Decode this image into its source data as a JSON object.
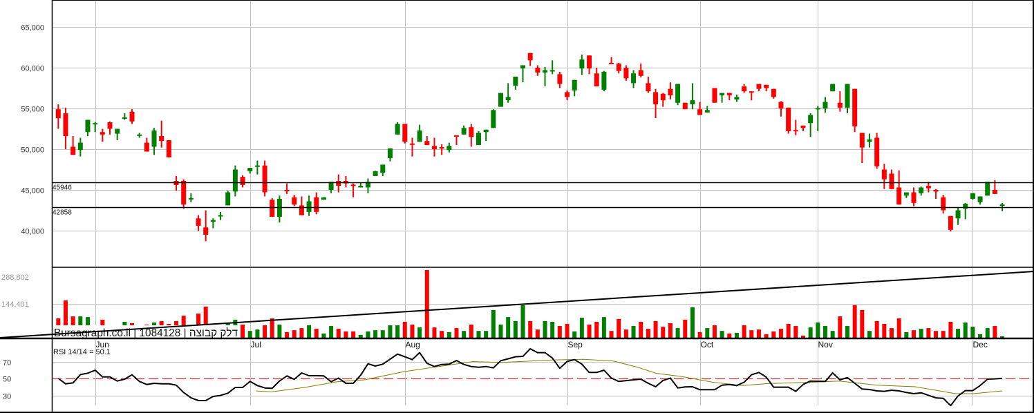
{
  "chart_data": {
    "type": "candlestick",
    "title": "",
    "watermark": "Bursagraph.co.il | 1084128 | דלק קבוצה",
    "colors": {
      "up": "#008000",
      "down": "#ff0000",
      "grid": "#c0c0c0",
      "rsi": "#000000",
      "rsi_ma": "#808000",
      "rsi_mid": "#ff0000"
    },
    "months": [
      {
        "label": "Jun",
        "index": 5
      },
      {
        "label": "Jul",
        "index": 26
      },
      {
        "label": "Aug",
        "index": 47
      },
      {
        "label": "Sep",
        "index": 69
      },
      {
        "label": "Oct",
        "index": 87
      },
      {
        "label": "Nov",
        "index": 103
      },
      {
        "label": "Dec",
        "index": 124
      }
    ],
    "price_axis": {
      "ylim": [
        35590,
        68300
      ],
      "ticks": [
        65000,
        60000,
        55000,
        50000,
        45000,
        40000
      ],
      "labels": [
        "65,000",
        "60,000",
        "55,000",
        "50,000",
        "45,000",
        "40,000"
      ]
    },
    "levels": [
      {
        "value": 45946,
        "label": "45946"
      },
      {
        "value": 42858,
        "label": "42858"
      }
    ],
    "ohlc_fields": [
      "open",
      "high",
      "low",
      "close"
    ],
    "ohlc": [
      [
        54900,
        55500,
        52500,
        53800
      ],
      [
        54400,
        55100,
        50000,
        51600
      ],
      [
        50300,
        51600,
        49300,
        49300
      ],
      [
        49900,
        51400,
        49100,
        50800
      ],
      [
        52100,
        53600,
        51600,
        53600
      ],
      [
        53150,
        53330,
        52100,
        53200
      ],
      [
        52100,
        52500,
        50900,
        51800
      ],
      [
        53300,
        53400,
        51800,
        52500
      ],
      [
        51900,
        52500,
        51100,
        52500
      ],
      [
        53850,
        54400,
        53600,
        53900
      ],
      [
        54600,
        54900,
        53100,
        53400
      ],
      [
        51750,
        52000,
        51400,
        51800
      ],
      [
        50800,
        51400,
        49700,
        49700
      ],
      [
        50300,
        52600,
        49300,
        52300
      ],
      [
        51600,
        53500,
        50200,
        51000
      ],
      [
        51100,
        51100,
        49000,
        49000
      ],
      [
        46100,
        46700,
        44900,
        45600
      ],
      [
        46100,
        46300,
        42700,
        43200
      ],
      [
        43950,
        44600,
        43500,
        44000
      ],
      [
        41500,
        41900,
        40000,
        40600
      ],
      [
        40400,
        42500,
        38700,
        39500
      ],
      [
        41100,
        41500,
        40300,
        41300
      ],
      [
        41850,
        42300,
        41300,
        41900
      ],
      [
        43100,
        44900,
        43100,
        44700
      ],
      [
        44800,
        48000,
        44200,
        47500
      ],
      [
        46600,
        46800,
        45300,
        45600
      ],
      [
        47300,
        47700,
        47000,
        47700
      ],
      [
        47950,
        48600,
        46900,
        48000
      ],
      [
        48000,
        48600,
        44200,
        44700
      ],
      [
        43800,
        44000,
        41700,
        41700
      ],
      [
        41700,
        44300,
        41000,
        43900
      ],
      [
        45000,
        45800,
        44500,
        44900
      ],
      [
        44100,
        44400,
        43000,
        43200
      ],
      [
        43100,
        44200,
        41900,
        41900
      ],
      [
        42300,
        44300,
        41800,
        43600
      ],
      [
        44100,
        44700,
        42000,
        42300
      ],
      [
        43800,
        44100,
        43800,
        44100
      ],
      [
        45000,
        46000,
        44600,
        46000
      ],
      [
        46100,
        46900,
        44700,
        45500
      ],
      [
        46100,
        46700,
        45300,
        45800
      ],
      [
        45650,
        45800,
        44100,
        45600
      ],
      [
        45300,
        45900,
        45300,
        45500
      ],
      [
        45300,
        46400,
        44600,
        46000
      ],
      [
        46700,
        47350,
        46700,
        47300
      ],
      [
        47100,
        48100,
        46700,
        48100
      ],
      [
        48900,
        50100,
        48500,
        50100
      ],
      [
        51800,
        53300,
        51800,
        53100
      ],
      [
        53100,
        53100,
        50700,
        50900
      ],
      [
        50700,
        51400,
        49100,
        50650
      ],
      [
        50900,
        53000,
        50900,
        52300
      ],
      [
        51000,
        51600,
        50500,
        50500
      ],
      [
        50400,
        51400,
        49100,
        50000
      ],
      [
        50250,
        50600,
        49300,
        50225
      ],
      [
        49900,
        50800,
        49600,
        50400
      ],
      [
        51700,
        51700,
        50500,
        51650
      ],
      [
        51800,
        52900,
        51800,
        52600
      ],
      [
        52700,
        53100,
        50300,
        51500
      ],
      [
        50500,
        52200,
        50500,
        52000
      ],
      [
        52100,
        52400,
        51000,
        52400
      ],
      [
        52600,
        54900,
        52600,
        54800
      ],
      [
        55200,
        56900,
        55200,
        56900
      ],
      [
        56000,
        58100,
        55700,
        56400
      ],
      [
        57800,
        58900,
        57300,
        58900
      ],
      [
        59900,
        60300,
        58200,
        60300
      ],
      [
        61800,
        61800,
        60200,
        60900
      ],
      [
        60000,
        60300,
        59000,
        59400
      ],
      [
        59400,
        60100,
        57700,
        59700
      ],
      [
        59650,
        60900,
        59200,
        59700
      ],
      [
        59200,
        59500,
        57500,
        58000
      ],
      [
        57000,
        57200,
        56000,
        56400
      ],
      [
        57200,
        58500,
        56500,
        58500
      ],
      [
        59900,
        61600,
        59100,
        61000
      ],
      [
        61500,
        61500,
        59200,
        59900
      ],
      [
        59300,
        60000,
        57700,
        57700
      ],
      [
        57300,
        59600,
        57100,
        59500
      ],
      [
        60600,
        61300,
        60550,
        60560
      ],
      [
        60500,
        60600,
        59300,
        59600
      ],
      [
        60000,
        60300,
        58400,
        58700
      ],
      [
        58100,
        59700,
        57500,
        59300
      ],
      [
        59700,
        60500,
        58800,
        59000
      ],
      [
        58100,
        58900,
        56900,
        57100
      ],
      [
        57000,
        57400,
        53800,
        55500
      ],
      [
        56800,
        56900,
        55200,
        56000
      ],
      [
        57400,
        58200,
        56100,
        56600
      ],
      [
        55700,
        58000,
        55400,
        58000
      ],
      [
        55700,
        55700,
        54900,
        54900
      ],
      [
        55500,
        58100,
        54900,
        56000
      ],
      [
        54900,
        55800,
        54200,
        54200
      ],
      [
        54500,
        55300,
        54500,
        54800
      ],
      [
        57500,
        57500,
        55700,
        55700
      ],
      [
        56600,
        56900,
        55700,
        56900
      ],
      [
        56900,
        56900,
        56000,
        56600
      ],
      [
        56100,
        56700,
        55800,
        56400
      ],
      [
        57700,
        58000,
        56900,
        57100
      ],
      [
        57100,
        57100,
        56000,
        57050
      ],
      [
        58000,
        58000,
        57100,
        57400
      ],
      [
        57900,
        57900,
        57100,
        57500
      ],
      [
        57400,
        57400,
        56200,
        56400
      ],
      [
        55800,
        55900,
        54000,
        55000
      ],
      [
        55100,
        55100,
        51900,
        52200
      ],
      [
        52350,
        53600,
        51700,
        52300
      ],
      [
        52900,
        52900,
        52200,
        52600
      ],
      [
        53200,
        54400,
        51500,
        54200
      ],
      [
        55000,
        55300,
        52200,
        55050
      ],
      [
        55000,
        56400,
        54500,
        55800
      ],
      [
        57100,
        58000,
        57100,
        58000
      ],
      [
        55700,
        57100,
        54600,
        55100
      ],
      [
        55100,
        58000,
        54400,
        58000
      ],
      [
        57400,
        57400,
        52100,
        52800
      ],
      [
        52000,
        52000,
        48300,
        50200
      ],
      [
        50900,
        51900,
        50200,
        51200
      ],
      [
        51400,
        52000,
        47600,
        47900
      ],
      [
        47500,
        48200,
        45100,
        46300
      ],
      [
        47000,
        47500,
        45100,
        45100
      ],
      [
        45300,
        47400,
        43200,
        43200
      ],
      [
        44300,
        44700,
        44000,
        44700
      ],
      [
        44700,
        45300,
        43000,
        43400
      ],
      [
        44600,
        45400,
        44300,
        45300
      ],
      [
        45500,
        46000,
        44700,
        45200
      ],
      [
        45000,
        45100,
        43900,
        44800
      ],
      [
        44100,
        44400,
        42100,
        42500
      ],
      [
        41800,
        41800,
        39900,
        40100
      ],
      [
        41500,
        42800,
        40700,
        42500
      ],
      [
        42700,
        43400,
        41400,
        43300
      ],
      [
        43900,
        44600,
        43800,
        44600
      ],
      [
        43500,
        44200,
        43200,
        44200
      ],
      [
        44300,
        46000,
        44300,
        46000
      ],
      [
        45000,
        46200,
        44500,
        44500
      ],
      [
        43200,
        43400,
        42400,
        43220
      ]
    ],
    "volume_axis": {
      "ticks": [
        288802,
        144401
      ],
      "labels": [
        "288,802",
        "144,401"
      ]
    },
    "volume": [
      82500,
      159000,
      91000,
      91000,
      88000,
      30000,
      77000,
      35000,
      30000,
      68000,
      62000,
      25000,
      56000,
      65000,
      71000,
      59000,
      71000,
      94000,
      30000,
      103000,
      133000,
      30000,
      35000,
      65000,
      77000,
      56000,
      29000,
      35000,
      53000,
      82500,
      56000,
      24000,
      32000,
      41000,
      53000,
      38000,
      18000,
      50000,
      38000,
      27000,
      27000,
      12000,
      27000,
      32000,
      32000,
      53000,
      53000,
      68000,
      56000,
      44000,
      289000,
      44000,
      29000,
      24000,
      41000,
      29000,
      56000,
      29000,
      29000,
      118000,
      56000,
      88000,
      71000,
      139000,
      71000,
      35000,
      71000,
      68000,
      50000,
      59000,
      27000,
      85000,
      56000,
      68000,
      88000,
      29000,
      80000,
      35000,
      50000,
      68000,
      38000,
      71000,
      47000,
      62000,
      41000,
      77000,
      130000,
      24000,
      41000,
      53000,
      29000,
      18000,
      21000,
      53000,
      32000,
      35000,
      15000,
      27000,
      38000,
      59000,
      50000,
      9000,
      44000,
      65000,
      50000,
      29000,
      91000,
      50000,
      139000,
      118000,
      29000,
      71000,
      59000,
      41000,
      82500,
      24000,
      32000,
      38000,
      41000,
      29000,
      29000,
      68000,
      38000,
      65000,
      47000,
      15000,
      41000,
      50000,
      6000
    ],
    "volume_trendline": [
      [
        -7.9,
        0
      ],
      [
        132.3,
        283000
      ]
    ],
    "rsi": {
      "label": "RSI 14/14 = 50.1",
      "ticks": [
        70,
        50,
        30
      ],
      "tick_labels": [
        "70",
        "50",
        "30"
      ],
      "ylim": [
        11,
        100
      ],
      "values": [
        50,
        43.7,
        44.8,
        54.6,
        56.3,
        59.8,
        51.9,
        51.9,
        47,
        49.2,
        54.4,
        46.5,
        42.9,
        44.3,
        43.7,
        43.7,
        42.1,
        33.4,
        27.1,
        23.9,
        23.9,
        28.8,
        29.9,
        32.6,
        39.4,
        39.4,
        46.5,
        41.6,
        38.8,
        38.3,
        47,
        53,
        48.9,
        56.5,
        53.3,
        53.3,
        53,
        46.2,
        50.5,
        44.3,
        44.3,
        53.8,
        67.4,
        64.7,
        66.9,
        72.8,
        78.8,
        75.6,
        72.3,
        80.5,
        68,
        64.1,
        66.6,
        66.9,
        71.2,
        66.6,
        64.1,
        63.3,
        64.1,
        62.5,
        71,
        73.3,
        75.6,
        76.1,
        85.1,
        80.5,
        80.5,
        74.2,
        62,
        70.1,
        72.3,
        66.9,
        57.1,
        57.1,
        59.8,
        50.5,
        46.5,
        47.5,
        48.4,
        49.2,
        44.3,
        40.2,
        47.6,
        50.5,
        38.8,
        40,
        40.2,
        36.7,
        36.7,
        36.7,
        42.1,
        42.9,
        41.6,
        45.6,
        54.4,
        57.1,
        51.6,
        39.7,
        39.7,
        39.7,
        34.8,
        42.9,
        47,
        46.7,
        46.5,
        56.5,
        48.4,
        51.1,
        44.3,
        37.5,
        36.9,
        35.3,
        34.8,
        36.1,
        35.3,
        33.4,
        32,
        33.1,
        30.1,
        27.1,
        26.6,
        17.9,
        29.3,
        35.6,
        35.6,
        41.6,
        49.2,
        49.5,
        50.1
      ],
      "ma": [
        [
          26.8,
          35.3
        ],
        [
          28.9,
          34.2
        ],
        [
          33.4,
          39.4
        ],
        [
          37.8,
          46.2
        ],
        [
          41.5,
          48.4
        ],
        [
          46.8,
          57.9
        ],
        [
          53.5,
          66.6
        ],
        [
          56.2,
          69.9
        ],
        [
          60.2,
          69
        ],
        [
          66.9,
          71.8
        ],
        [
          71.2,
          72.6
        ],
        [
          75.2,
          70.7
        ],
        [
          78.5,
          63.5
        ],
        [
          81.1,
          56
        ],
        [
          84.5,
          52.4
        ],
        [
          88.7,
          45.6
        ],
        [
          92.8,
          41.6
        ],
        [
          96.2,
          44
        ],
        [
          102.4,
          45.6
        ],
        [
          105.9,
          47
        ],
        [
          111,
          42.1
        ],
        [
          116.2,
          40.2
        ],
        [
          121.7,
          32
        ],
        [
          124.1,
          32
        ],
        [
          128,
          35.3
        ]
      ]
    }
  }
}
